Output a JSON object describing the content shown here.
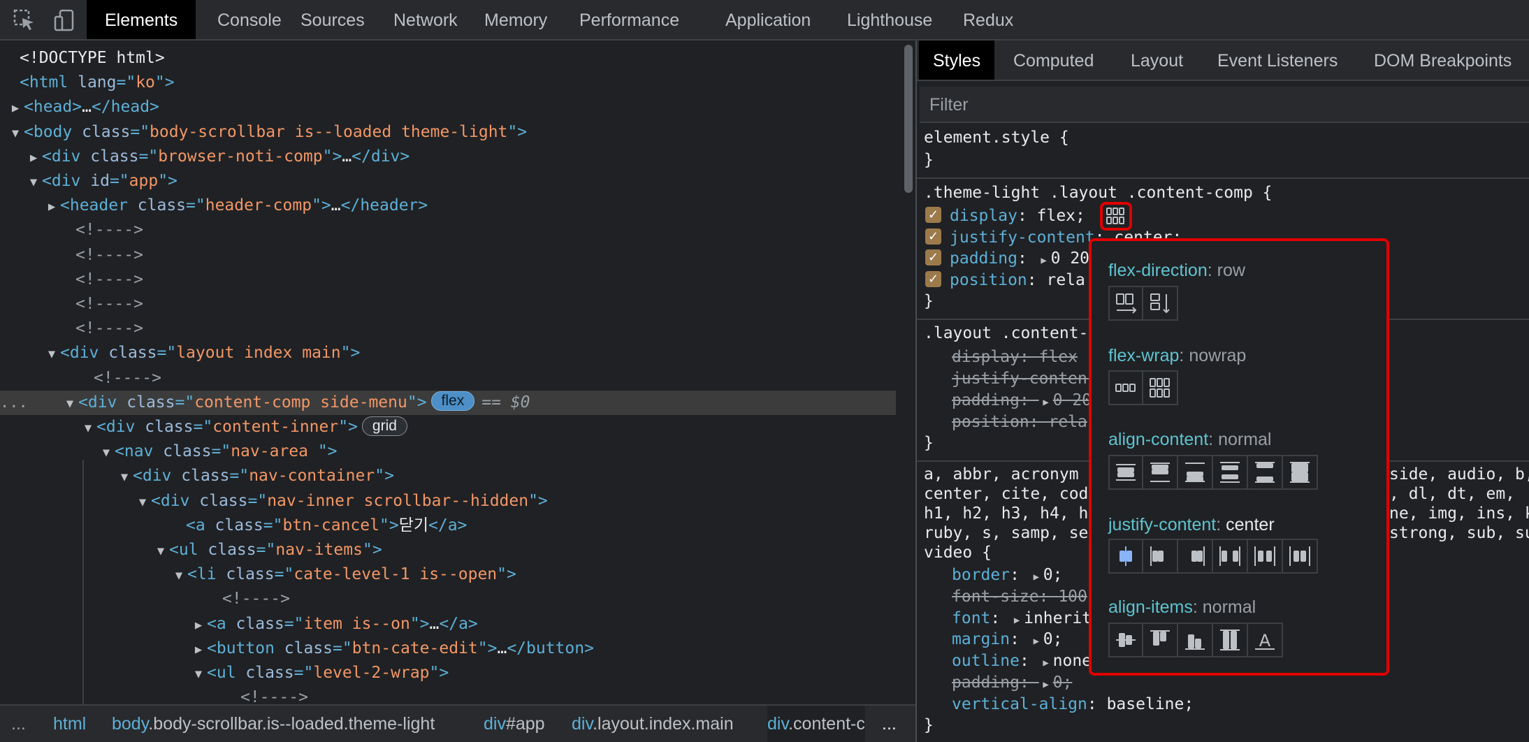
{
  "toolbar": {
    "tabs": [
      "Elements",
      "Console",
      "Sources",
      "Network",
      "Memory",
      "Performance",
      "Application",
      "Lighthouse",
      "Redux"
    ],
    "active_tab": "Elements"
  },
  "dom": {
    "lines": [
      {
        "segments": [
          {
            "c": "txt",
            "t": "<!DOCTYPE html>"
          }
        ]
      },
      {
        "segments": [
          {
            "c": "tag",
            "t": "<html "
          },
          {
            "c": "attr",
            "t": "lang"
          },
          {
            "c": "tag",
            "t": "=\""
          },
          {
            "c": "aval",
            "t": "ko"
          },
          {
            "c": "tag",
            "t": "\">"
          }
        ]
      },
      {
        "segments": [
          {
            "c": "tag",
            "t": "<head>"
          },
          {
            "c": "txt",
            "t": "…"
          },
          {
            "c": "tag",
            "t": "</head>"
          }
        ]
      },
      {
        "segments": [
          {
            "c": "tag",
            "t": "<body "
          },
          {
            "c": "attr",
            "t": "class"
          },
          {
            "c": "tag",
            "t": "=\""
          },
          {
            "c": "aval",
            "t": "body-scrollbar is--loaded theme-light"
          },
          {
            "c": "tag",
            "t": "\">"
          }
        ]
      },
      {
        "segments": [
          {
            "c": "tag",
            "t": "<div "
          },
          {
            "c": "attr",
            "t": "class"
          },
          {
            "c": "tag",
            "t": "=\""
          },
          {
            "c": "aval",
            "t": "browser-noti-comp"
          },
          {
            "c": "tag",
            "t": "\">"
          },
          {
            "c": "txt",
            "t": "…"
          },
          {
            "c": "tag",
            "t": "</div>"
          }
        ]
      },
      {
        "segments": [
          {
            "c": "tag",
            "t": "<div "
          },
          {
            "c": "attr",
            "t": "id"
          },
          {
            "c": "tag",
            "t": "=\""
          },
          {
            "c": "aval",
            "t": "app"
          },
          {
            "c": "tag",
            "t": "\">"
          }
        ]
      },
      {
        "segments": [
          {
            "c": "tag",
            "t": "<header "
          },
          {
            "c": "attr",
            "t": "class"
          },
          {
            "c": "tag",
            "t": "=\""
          },
          {
            "c": "aval",
            "t": "header-comp"
          },
          {
            "c": "tag",
            "t": "\">"
          },
          {
            "c": "txt",
            "t": "…"
          },
          {
            "c": "tag",
            "t": "</header>"
          }
        ]
      },
      {
        "segments": [
          {
            "c": "cmt",
            "t": "<!---->"
          }
        ]
      },
      {
        "segments": [
          {
            "c": "cmt",
            "t": "<!---->"
          }
        ]
      },
      {
        "segments": [
          {
            "c": "cmt",
            "t": "<!---->"
          }
        ]
      },
      {
        "segments": [
          {
            "c": "cmt",
            "t": "<!---->"
          }
        ]
      },
      {
        "segments": [
          {
            "c": "cmt",
            "t": "<!---->"
          }
        ]
      },
      {
        "segments": [
          {
            "c": "tag",
            "t": "<div "
          },
          {
            "c": "attr",
            "t": "class"
          },
          {
            "c": "tag",
            "t": "=\""
          },
          {
            "c": "aval",
            "t": "layout index main"
          },
          {
            "c": "tag",
            "t": "\">"
          }
        ]
      },
      {
        "segments": [
          {
            "c": "cmt",
            "t": "<!---->"
          }
        ]
      },
      {
        "segments": [
          {
            "c": "tag",
            "t": "<div "
          },
          {
            "c": "attr",
            "t": "class"
          },
          {
            "c": "tag",
            "t": "=\""
          },
          {
            "c": "aval",
            "t": "content-comp side-menu"
          },
          {
            "c": "tag",
            "t": "\">"
          }
        ],
        "badge": "flex",
        "selected_marker": "== $0"
      },
      {
        "segments": [
          {
            "c": "tag",
            "t": "<div "
          },
          {
            "c": "attr",
            "t": "class"
          },
          {
            "c": "tag",
            "t": "=\""
          },
          {
            "c": "aval",
            "t": "content-inner"
          },
          {
            "c": "tag",
            "t": "\">"
          }
        ],
        "badge": "grid"
      },
      {
        "segments": [
          {
            "c": "tag",
            "t": "<nav "
          },
          {
            "c": "attr",
            "t": "class"
          },
          {
            "c": "tag",
            "t": "=\""
          },
          {
            "c": "aval",
            "t": "nav-area "
          },
          {
            "c": "tag",
            "t": "\">"
          }
        ]
      },
      {
        "segments": [
          {
            "c": "tag",
            "t": "<div "
          },
          {
            "c": "attr",
            "t": "class"
          },
          {
            "c": "tag",
            "t": "=\""
          },
          {
            "c": "aval",
            "t": "nav-container"
          },
          {
            "c": "tag",
            "t": "\">"
          }
        ]
      },
      {
        "segments": [
          {
            "c": "tag",
            "t": "<div "
          },
          {
            "c": "attr",
            "t": "class"
          },
          {
            "c": "tag",
            "t": "=\""
          },
          {
            "c": "aval",
            "t": "nav-inner scrollbar--hidden"
          },
          {
            "c": "tag",
            "t": "\">"
          }
        ]
      },
      {
        "segments": [
          {
            "c": "tag",
            "t": "<a "
          },
          {
            "c": "attr",
            "t": "class"
          },
          {
            "c": "tag",
            "t": "=\""
          },
          {
            "c": "aval",
            "t": "btn-cancel"
          },
          {
            "c": "tag",
            "t": "\">"
          },
          {
            "c": "txt",
            "t": "닫기"
          },
          {
            "c": "tag",
            "t": "</a>"
          }
        ]
      },
      {
        "segments": [
          {
            "c": "tag",
            "t": "<ul "
          },
          {
            "c": "attr",
            "t": "class"
          },
          {
            "c": "tag",
            "t": "=\""
          },
          {
            "c": "aval",
            "t": "nav-items"
          },
          {
            "c": "tag",
            "t": "\">"
          }
        ]
      },
      {
        "segments": [
          {
            "c": "tag",
            "t": "<li "
          },
          {
            "c": "attr",
            "t": "class"
          },
          {
            "c": "tag",
            "t": "=\""
          },
          {
            "c": "aval",
            "t": "cate-level-1  is--open"
          },
          {
            "c": "tag",
            "t": "\">"
          }
        ]
      },
      {
        "segments": [
          {
            "c": "cmt",
            "t": "<!---->"
          }
        ]
      },
      {
        "segments": [
          {
            "c": "tag",
            "t": "<a "
          },
          {
            "c": "attr",
            "t": "class"
          },
          {
            "c": "tag",
            "t": "=\""
          },
          {
            "c": "aval",
            "t": "item is--on"
          },
          {
            "c": "tag",
            "t": "\">"
          },
          {
            "c": "txt",
            "t": "…"
          },
          {
            "c": "tag",
            "t": "</a>"
          }
        ]
      },
      {
        "segments": [
          {
            "c": "tag",
            "t": "<button "
          },
          {
            "c": "attr",
            "t": "class"
          },
          {
            "c": "tag",
            "t": "=\""
          },
          {
            "c": "aval",
            "t": "btn-cate-edit"
          },
          {
            "c": "tag",
            "t": "\">"
          },
          {
            "c": "txt",
            "t": "…"
          },
          {
            "c": "tag",
            "t": "</button>"
          }
        ]
      },
      {
        "segments": [
          {
            "c": "tag",
            "t": "<ul "
          },
          {
            "c": "attr",
            "t": "class"
          },
          {
            "c": "tag",
            "t": "=\""
          },
          {
            "c": "aval",
            "t": "level-2-wrap"
          },
          {
            "c": "tag",
            "t": "\">"
          }
        ]
      },
      {
        "segments": [
          {
            "c": "cmt",
            "t": "<!---->"
          }
        ]
      }
    ],
    "more_marker": "..."
  },
  "breadcrumb": {
    "leading": "...",
    "trailing": "...",
    "items": [
      {
        "tag": "html",
        "rest": ""
      },
      {
        "tag": "body",
        "rest": ".body-scrollbar.is--loaded.theme-light"
      },
      {
        "tag": "div",
        "rest": "#app"
      },
      {
        "tag": "div",
        "rest": ".layout.index.main"
      },
      {
        "tag": "div",
        "rest": ".content-c"
      }
    ]
  },
  "styles": {
    "tabs": [
      "Styles",
      "Computed",
      "Layout",
      "Event Listeners",
      "DOM Breakpoints"
    ],
    "active_tab": "Styles",
    "filter_placeholder": "Filter",
    "element_style": "element.style {",
    "close_brace": "}",
    "rule1": {
      "selector": ".theme-light .layout .content-comp {",
      "props": [
        {
          "name": "display",
          "value": "flex;"
        },
        {
          "name": "justify-content",
          "value": "center;"
        },
        {
          "name": "padding",
          "value": "0 20"
        },
        {
          "name": "position",
          "value": "rela"
        }
      ]
    },
    "rule2": {
      "selector": ".layout .content-",
      "props": [
        {
          "name": "display",
          "value": "flex"
        },
        {
          "name": "justify-conten",
          "value": ""
        },
        {
          "name": "padding",
          "value": "0 20"
        },
        {
          "name": "position",
          "value": "rela"
        }
      ]
    },
    "rule3": {
      "selector_lines": [
        {
          "left": "a, abbr, acronym",
          "right": "side, audio, b,"
        },
        {
          "left": "center, cite, cod",
          "right": ", dl, dt, em,"
        },
        {
          "left": "h1, h2, h3, h4, h",
          "right": "ne, img, ins, k"
        },
        {
          "left": "ruby, s, samp, se",
          "right": "strong, sub, su"
        },
        {
          "left": "video {",
          "right": ""
        }
      ],
      "props": [
        {
          "name": "border",
          "value": "0;",
          "struck": false,
          "expand": true
        },
        {
          "name": "font-size",
          "value": "100",
          "struck": true,
          "expand": false
        },
        {
          "name": "font",
          "value": "inherit",
          "struck": false,
          "expand": true
        },
        {
          "name": "margin",
          "value": "0;",
          "struck": false,
          "expand": true
        },
        {
          "name": "outline",
          "value": "none",
          "struck": false,
          "expand": true
        },
        {
          "name": "padding",
          "value": "0;",
          "struck": true,
          "expand": true
        },
        {
          "name": "vertical-align",
          "value": "baseline;",
          "struck": false,
          "expand": false
        }
      ]
    }
  },
  "flex_editor": {
    "sections": [
      {
        "key": "flex-direction",
        "value": "row",
        "value_white": false,
        "buttons": [
          "row",
          "column"
        ]
      },
      {
        "key": "flex-wrap",
        "value": "nowrap",
        "value_white": false,
        "buttons": [
          "nowrap",
          "wrap"
        ]
      },
      {
        "key": "align-content",
        "value": "normal",
        "value_white": false,
        "buttons": [
          "center",
          "flex-start",
          "flex-end",
          "space-around",
          "space-between",
          "stretch"
        ]
      },
      {
        "key": "justify-content",
        "value": "center",
        "value_white": true,
        "buttons": [
          "center",
          "flex-start",
          "flex-end",
          "space-between",
          "space-around",
          "space-evenly"
        ]
      },
      {
        "key": "align-items",
        "value": "normal",
        "value_white": false,
        "buttons": [
          "center",
          "flex-start",
          "flex-end",
          "stretch",
          "baseline"
        ]
      }
    ],
    "active_button": {
      "section": "justify-content",
      "index": 0
    }
  },
  "colors": {
    "accent_red": "#e00000",
    "active_icon": "#8ab4f8"
  }
}
